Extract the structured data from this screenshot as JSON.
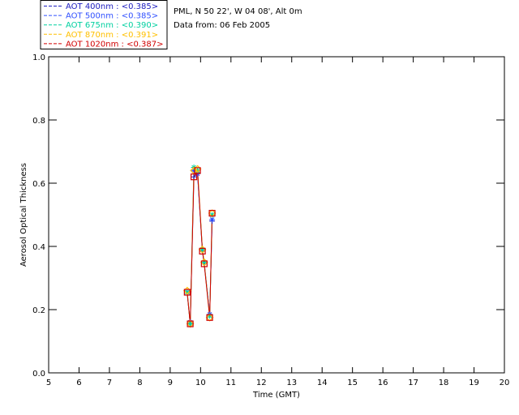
{
  "chart_data": {
    "type": "line",
    "xlabel": "Time (GMT)",
    "ylabel": "Aerosol Optical Thickness",
    "xlim": [
      5,
      20
    ],
    "ylim": [
      0.0,
      1.0
    ],
    "xticks": [
      5,
      6,
      7,
      8,
      9,
      10,
      11,
      12,
      13,
      14,
      15,
      16,
      17,
      18,
      19,
      20
    ],
    "yticks": [
      0.0,
      0.2,
      0.4,
      0.6,
      0.8,
      1.0
    ],
    "ytick_labels": [
      "0.0",
      "0.2",
      "0.4",
      "0.6",
      "0.8",
      "1.0"
    ],
    "grid": false,
    "info": {
      "location": "PML, N 50 22', W 04 08', Alt 0m",
      "date": "Data from: 06 Feb 2005"
    },
    "legend_position": "top-left-outside",
    "series": [
      {
        "name": "AOT  400nm : <0.385>",
        "color": "#2020c0",
        "marker": "plus",
        "x": [
          9.56,
          9.66,
          9.78,
          9.9,
          10.06,
          10.12,
          10.3,
          10.38
        ],
        "y": [
          0.255,
          0.155,
          0.62,
          0.63,
          0.385,
          0.345,
          0.185,
          0.48
        ]
      },
      {
        "name": "AOT  500nm : <0.385>",
        "color": "#3050ff",
        "marker": "asterisk",
        "x": [
          9.56,
          9.66,
          9.78,
          9.9,
          10.06,
          10.12,
          10.3,
          10.38
        ],
        "y": [
          0.255,
          0.16,
          0.64,
          0.63,
          0.39,
          0.35,
          0.185,
          0.485
        ]
      },
      {
        "name": "AOT  675nm : <0.390>",
        "color": "#00d0a0",
        "marker": "asterisk",
        "x": [
          9.56,
          9.66,
          9.78,
          9.9,
          10.06,
          10.12,
          10.3,
          10.38
        ],
        "y": [
          0.255,
          0.155,
          0.65,
          0.64,
          0.39,
          0.35,
          0.18,
          0.5
        ]
      },
      {
        "name": "AOT  870nm : <0.391>",
        "color": "#ffc000",
        "marker": "diamond",
        "x": [
          9.56,
          9.66,
          9.78,
          9.9,
          10.06,
          10.12,
          10.3,
          10.38
        ],
        "y": [
          0.26,
          0.155,
          0.64,
          0.645,
          0.39,
          0.35,
          0.175,
          0.505
        ]
      },
      {
        "name": "AOT 1020nm : <0.387>",
        "color": "#d00000",
        "marker": "square",
        "x": [
          9.56,
          9.66,
          9.78,
          9.9,
          10.06,
          10.12,
          10.3,
          10.38
        ],
        "y": [
          0.255,
          0.155,
          0.62,
          0.64,
          0.385,
          0.345,
          0.175,
          0.505
        ]
      }
    ]
  }
}
